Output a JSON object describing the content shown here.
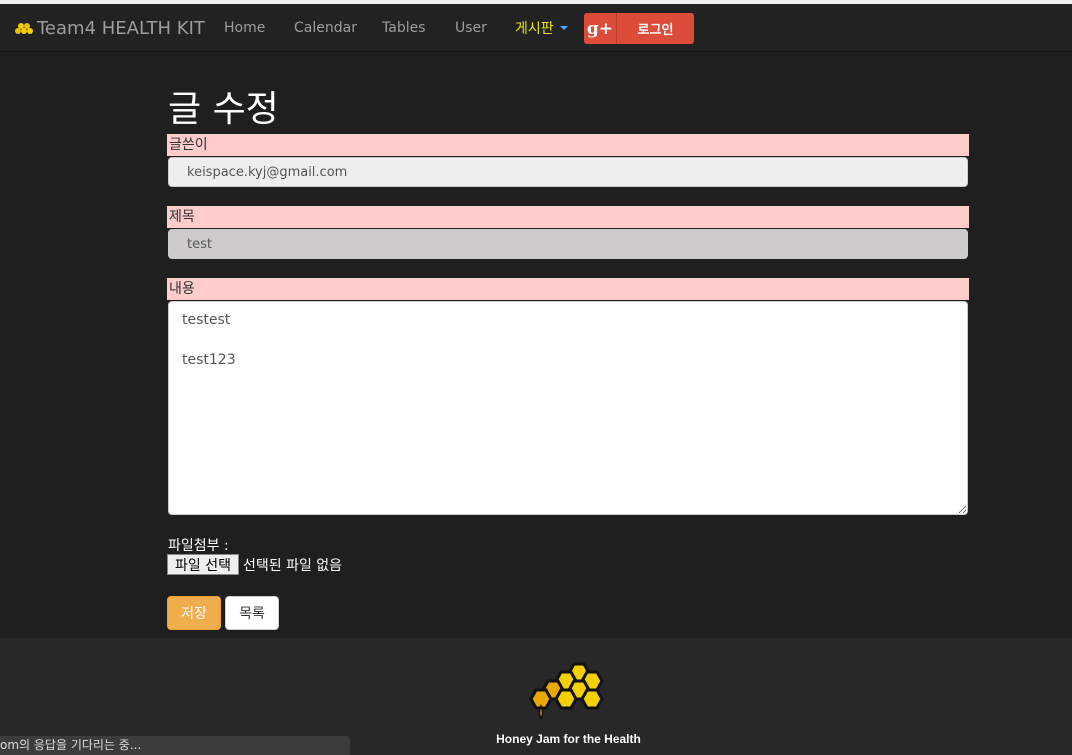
{
  "navbar": {
    "brand": "Team4 HEALTH KIT",
    "links": [
      "Home",
      "Calendar",
      "Tables",
      "User"
    ],
    "dropdown": "게시판",
    "google_icon": "g+",
    "login_label": "로그인"
  },
  "form": {
    "title": "글 수정",
    "author_label": "글쓴이",
    "author_value": "keispace.kyj@gmail.com",
    "subject_label": "제목",
    "subject_value": "test",
    "content_label": "내용",
    "content_value": "testest\n\ntest123",
    "file_label": "파일첨부 :",
    "file_button": "파일 선택",
    "file_status": "선택된 파일 없음",
    "save_button": "저장",
    "list_button": "목록"
  },
  "footer": {
    "tagline": "Honey Jam for the Health"
  },
  "statusbar": {
    "text": "om의 응답을 기다리는 중..."
  },
  "colors": {
    "accent": "#f0ad4e",
    "label_bg": "#ffcccc",
    "google_red": "#dd4b39",
    "honey": "#f5d000"
  }
}
